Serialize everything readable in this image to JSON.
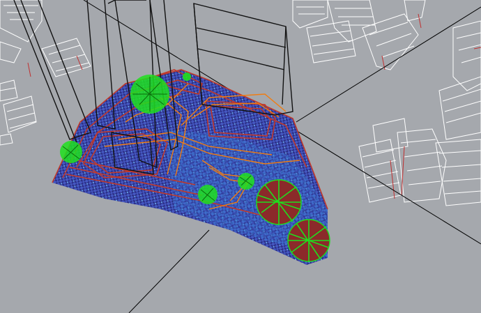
{
  "viewport": {
    "kind": "3d-wireframe-viewport",
    "background": "#a5a8ad",
    "colors": {
      "context_buildings": "#ffffff",
      "context_accent": "#c03030",
      "towers": "#111111",
      "site_boundary": "#c0392b",
      "paths": "#f07d12",
      "paving_dark": "#2f3590",
      "paving_mid": "#4a5bc8",
      "paving_light": "#3aa0e6",
      "trees": "#1ee01e",
      "tree_trunks": "#8b2020",
      "axes": "#000000"
    },
    "objects": [
      {
        "name": "context-buildings",
        "color_key": "context_buildings"
      },
      {
        "name": "towers",
        "color_key": "towers"
      },
      {
        "name": "site-boundary",
        "color_key": "site_boundary"
      },
      {
        "name": "paving",
        "color_key": "paving_mid"
      },
      {
        "name": "paths",
        "color_key": "paths"
      },
      {
        "name": "trees",
        "color_key": "trees"
      }
    ]
  }
}
